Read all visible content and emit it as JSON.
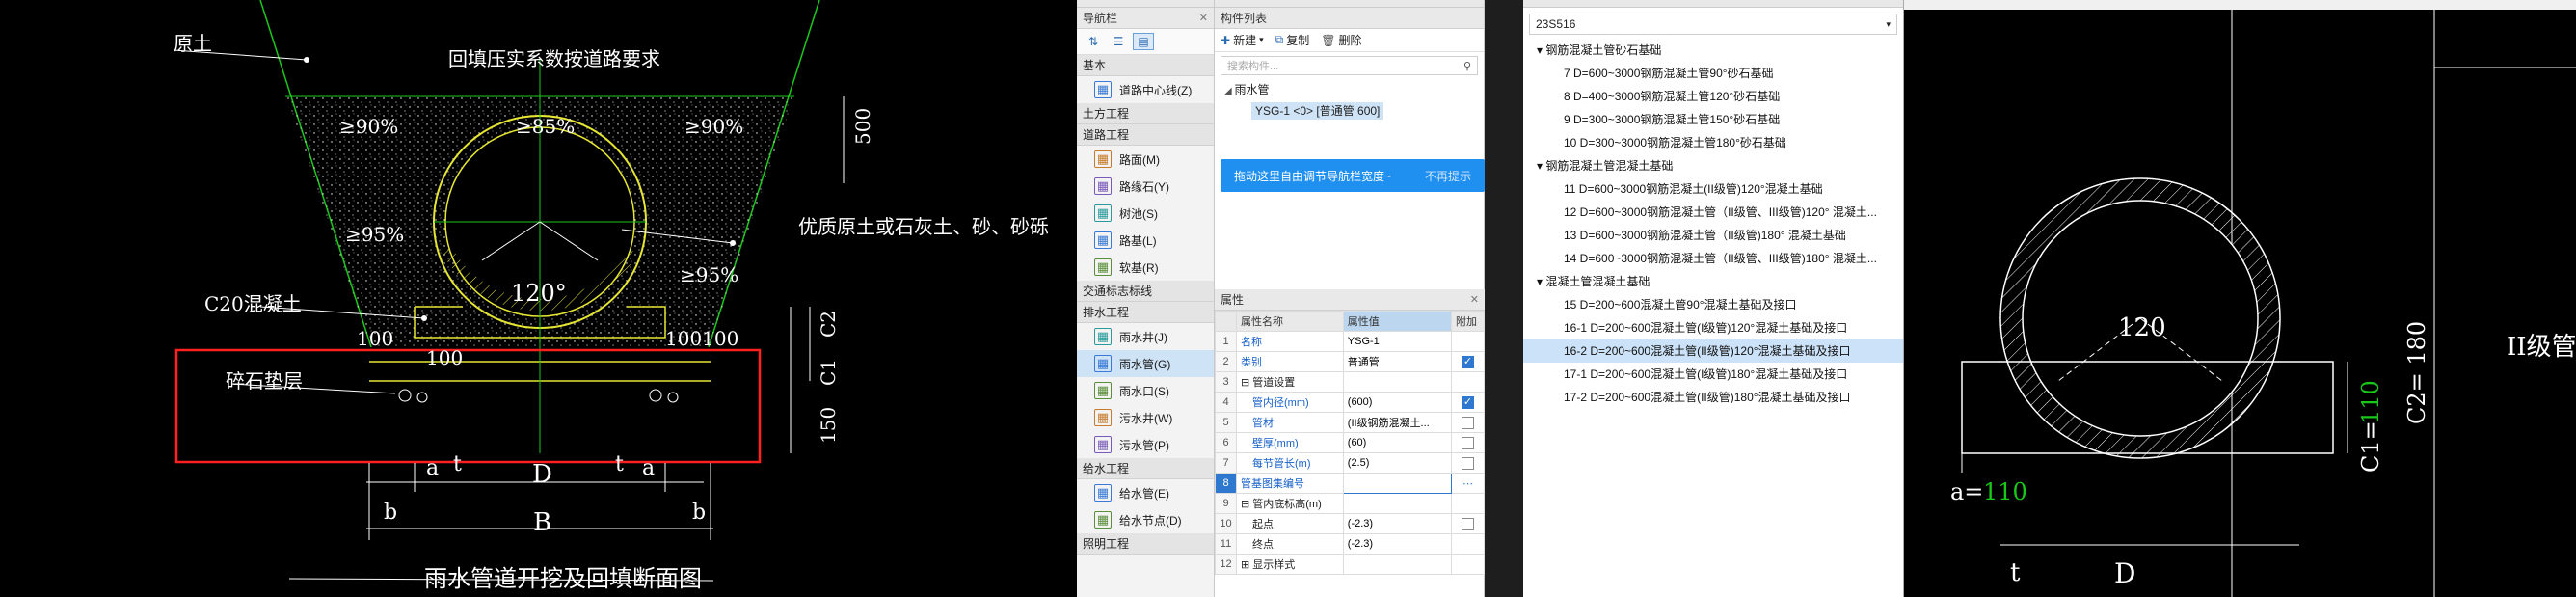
{
  "cad_left": {
    "labels": {
      "original_soil": "原土",
      "backfill_req": "回填压实系数按道路要求",
      "comp_90_left": "≥90%",
      "comp_85": "≥85%",
      "comp_90_right": "≥90%",
      "comp_95_left": "≥95%",
      "comp_95_right": "≥95%",
      "fill_material": "优质原土或石灰土、砂、砂砾",
      "c20": "C20混凝土",
      "gravel": "碎石垫层",
      "angle": "120°",
      "dim_500": "500",
      "dim_100_a": "100",
      "dim_100_b": "100",
      "dim_100_c": "100100",
      "dim_c1": "C1",
      "dim_c2": "C2",
      "dim_150": "150",
      "a1": "a",
      "t1": "t",
      "d": "D",
      "t2": "t",
      "a2": "a",
      "b1": "b",
      "bb": "B",
      "b2": "b",
      "title": "雨水管道开挖及回填断面图"
    }
  },
  "nav": {
    "title": "导航栏",
    "groups": [
      {
        "label": "基本",
        "items": [
          {
            "label": "道路中心线(Z)",
            "icon": "road-center-icon"
          }
        ]
      },
      {
        "label": "土方工程",
        "items": []
      },
      {
        "label": "道路工程",
        "items": [
          {
            "label": "路面(M)",
            "icon": "pavement-icon"
          },
          {
            "label": "路缘石(Y)",
            "icon": "curb-icon"
          },
          {
            "label": "树池(S)",
            "icon": "tree-pit-icon"
          },
          {
            "label": "路基(L)",
            "icon": "subgrade-icon"
          },
          {
            "label": "软基(R)",
            "icon": "soft-base-icon"
          }
        ]
      },
      {
        "label": "交通标志标线",
        "items": []
      },
      {
        "label": "排水工程",
        "items": [
          {
            "label": "雨水井(J)",
            "icon": "rain-well-icon"
          },
          {
            "label": "雨水管(G)",
            "icon": "rain-pipe-icon",
            "selected": true
          },
          {
            "label": "雨水口(S)",
            "icon": "rain-inlet-icon"
          },
          {
            "label": "污水井(W)",
            "icon": "sewage-well-icon"
          },
          {
            "label": "污水管(P)",
            "icon": "sewage-pipe-icon"
          }
        ]
      },
      {
        "label": "给水工程",
        "items": [
          {
            "label": "给水管(E)",
            "icon": "water-pipe-icon"
          },
          {
            "label": "给水节点(D)",
            "icon": "water-node-icon"
          }
        ]
      },
      {
        "label": "照明工程",
        "items": []
      }
    ]
  },
  "components": {
    "title": "构件列表",
    "new_label": "新建",
    "copy_label": "复制",
    "delete_label": "删除",
    "search_placeholder": "搜索构件...",
    "parent": "雨水管",
    "child": "YSG-1 <0> [普通管 600]",
    "tip_text": "拖动这里自由调节导航栏宽度~",
    "tip_dismiss": "不再提示"
  },
  "properties": {
    "title": "属性",
    "headers": [
      "属性名称",
      "属性值",
      "附加"
    ],
    "rows": [
      {
        "n": "1",
        "name": "名称",
        "value": "YSG-1",
        "check": "",
        "style": "blue"
      },
      {
        "n": "2",
        "name": "类别",
        "value": "普通管",
        "check": "on",
        "style": "blue"
      },
      {
        "n": "3",
        "name": "⊟ 管道设置",
        "value": "",
        "check": "",
        "style": "dark"
      },
      {
        "n": "4",
        "name": "管内径(mm)",
        "value": "(600)",
        "check": "on",
        "style": "blue",
        "indent": true
      },
      {
        "n": "5",
        "name": "管材",
        "value": "(II级钢筋混凝土...",
        "check": "off",
        "style": "blue",
        "indent": true
      },
      {
        "n": "6",
        "name": "壁厚(mm)",
        "value": "(60)",
        "check": "off",
        "style": "blue",
        "indent": true
      },
      {
        "n": "7",
        "name": "每节管长(m)",
        "value": "(2.5)",
        "check": "off",
        "style": "blue",
        "indent": true
      },
      {
        "n": "8",
        "name": "管基图集编号",
        "value": "",
        "check": "",
        "style": "blue",
        "editing": true
      },
      {
        "n": "9",
        "name": "⊟ 管内底标高(m)",
        "value": "",
        "check": "",
        "style": "dark"
      },
      {
        "n": "10",
        "name": "起点",
        "value": "(-2.3)",
        "check": "off",
        "style": "dark",
        "indent": true
      },
      {
        "n": "11",
        "name": "终点",
        "value": "(-2.3)",
        "check": "",
        "style": "dark",
        "indent": true
      },
      {
        "n": "12",
        "name": "⊞ 显示样式",
        "value": "",
        "check": "",
        "style": "dark"
      }
    ]
  },
  "atlas": {
    "dropdown": "23S516",
    "tree": [
      {
        "label": "▾ 钢筋混凝土管砂石基础",
        "level": 1
      },
      {
        "label": "7 D=600~3000钢筋混凝土管90°砂石基础",
        "level": 2
      },
      {
        "label": "8 D=400~3000钢筋混凝土管120°砂石基础",
        "level": 2
      },
      {
        "label": "9 D=300~3000钢筋混凝土管150°砂石基础",
        "level": 2
      },
      {
        "label": "10 D=300~3000钢筋混凝土管180°砂石基础",
        "level": 2
      },
      {
        "label": "▾ 钢筋混凝土管混凝土基础",
        "level": 1
      },
      {
        "label": "11 D=600~3000钢筋混凝土(II级管)120°混凝土基础",
        "level": 2
      },
      {
        "label": "12 D=600~3000钢筋混凝土管（II级管、III级管)120° 混凝土...",
        "level": 2
      },
      {
        "label": "13 D=600~3000钢筋混凝土管（II级管)180° 混凝土基础",
        "level": 2
      },
      {
        "label": "14 D=600~3000钢筋混凝土管（II级管、III级管)180° 混凝土...",
        "level": 2
      },
      {
        "label": "▾ 混凝土管混凝土基础",
        "level": 1
      },
      {
        "label": "15 D=200~600混凝土管90°混凝土基础及接口",
        "level": 2
      },
      {
        "label": "16-1 D=200~600混凝土管(I级管)120°混凝土基础及接口",
        "level": 2
      },
      {
        "label": "16-2 D=200~600混凝土管(II级管)120°混凝土基础及接口",
        "level": 2,
        "selected": true
      },
      {
        "label": "17-1 D=200~600混凝土管(I级管)180°混凝土基础及接口",
        "level": 2
      },
      {
        "label": "17-2 D=200~600混凝土管(II级管)180°混凝土基础及接口",
        "level": 2
      }
    ]
  },
  "cad_right": {
    "angle": "120",
    "a_label": "a=",
    "a_value": "110",
    "c1_label": "C1=",
    "c1_value": "110",
    "c2": "C2= 180",
    "grade": "II级管",
    "t": "t",
    "d": "D"
  },
  "colors": {
    "cad_green": "#19c919",
    "cad_white": "#ffffff",
    "cad_yellow": "#e6e632",
    "cad_red": "#ff2020",
    "ui_blue": "#1f8ff0"
  }
}
